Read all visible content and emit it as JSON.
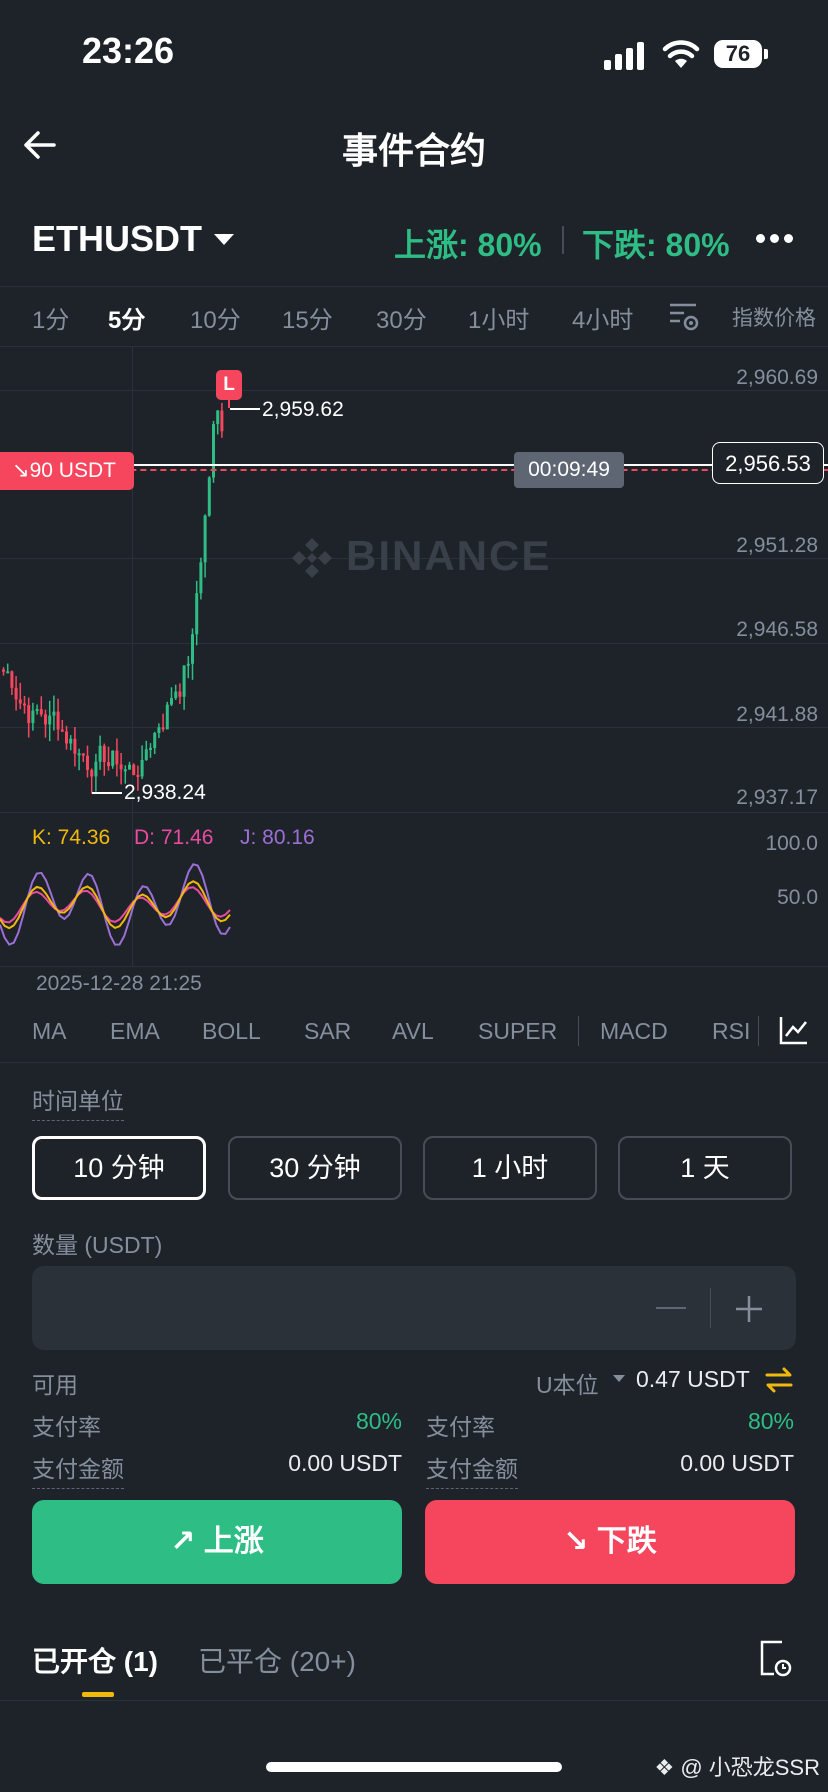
{
  "status": {
    "time": "23:26",
    "battery": "76"
  },
  "header": {
    "title": "事件合约"
  },
  "market": {
    "symbol": "ETHUSDT",
    "rise": "上涨: 80%",
    "fall": "下跌: 80%"
  },
  "intervals": [
    "1分",
    "5分",
    "10分",
    "15分",
    "30分",
    "1小时",
    "4小时"
  ],
  "active_interval": "5分",
  "index_price_label": "指数价格",
  "chart": {
    "y_labels": [
      "2,960.69",
      "2,956.53",
      "2,951.28",
      "2,946.58",
      "2,941.88",
      "2,937.17"
    ],
    "high_label": "2,959.62",
    "low_label": "2,938.24",
    "marker": "L",
    "position_tag": "90 USDT",
    "countdown": "00:09:49",
    "watermark": "BINANCE",
    "date_label": "2025-12-28 21:25"
  },
  "kdj": {
    "k": "K: 74.36",
    "d": "D: 71.46",
    "j": "J: 80.16",
    "y_labels": [
      "100.0",
      "50.0"
    ]
  },
  "indicators": [
    "MA",
    "EMA",
    "BOLL",
    "SAR",
    "AVL",
    "SUPER",
    "MACD",
    "RSI"
  ],
  "form": {
    "time_unit_label": "时间单位",
    "durations": [
      "10 分钟",
      "30 分钟",
      "1 小时",
      "1 天"
    ],
    "selected_duration": "10 分钟",
    "qty_label": "数量 (USDT)",
    "available_label": "可用",
    "unit_selector": "U本位",
    "available_value": "0.47 USDT",
    "rise_side": {
      "rate_label": "支付率",
      "rate_value": "80%",
      "amount_label": "支付金额",
      "amount_value": "0.00 USDT"
    },
    "fall_side": {
      "rate_label": "支付率",
      "rate_value": "80%",
      "amount_label": "支付金额",
      "amount_value": "0.00 USDT"
    },
    "rise_button": "上涨",
    "fall_button": "下跌"
  },
  "positions": {
    "open_tab": "已开仓 (1)",
    "closed_tab": "已平仓 (20+)"
  },
  "footer": {
    "watermark": "@ 小恐龙SSR"
  },
  "colors": {
    "bg": "#1e2329",
    "green": "#2ebd85",
    "red": "#f6465d",
    "yellow": "#f0b90b"
  }
}
